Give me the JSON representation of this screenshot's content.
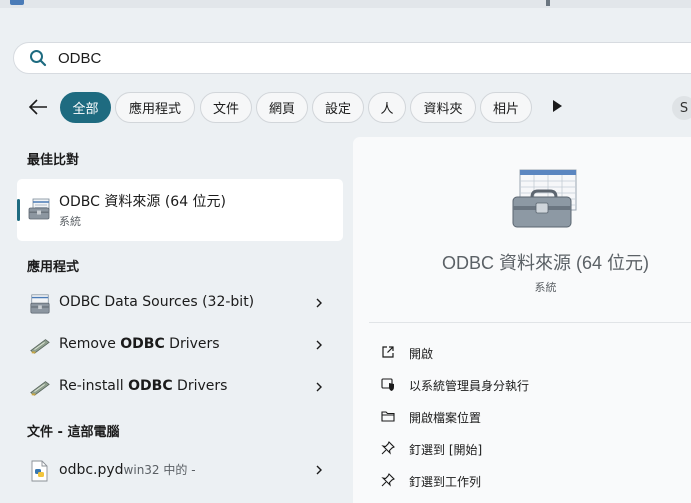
{
  "search": {
    "query": "ODBC"
  },
  "filters": {
    "chips": [
      {
        "label": "全部",
        "active": true
      },
      {
        "label": "應用程式"
      },
      {
        "label": "文件"
      },
      {
        "label": "網頁"
      },
      {
        "label": "設定"
      },
      {
        "label": "人"
      },
      {
        "label": "資料夾"
      },
      {
        "label": "相片"
      }
    ],
    "avatar_initial": "S"
  },
  "sections": {
    "best_match": "最佳比對",
    "apps": "應用程式",
    "documents": "文件 - 這部電腦"
  },
  "best_match": {
    "title": "ODBC 資料來源 (64 位元)",
    "subtitle": "系統"
  },
  "apps": [
    {
      "label": "ODBC Data Sources (32-bit)"
    },
    {
      "label_pre": "Remove ",
      "label_bold": "ODBC",
      "label_post": " Drivers"
    },
    {
      "label_pre": "Re-install ",
      "label_bold": "ODBC",
      "label_post": " Drivers"
    }
  ],
  "documents": [
    {
      "name": "odbc.pyd",
      "location": "win32 中的 -"
    }
  ],
  "detail": {
    "title": "ODBC 資料來源 (64 位元)",
    "subtitle": "系統",
    "actions": [
      {
        "label": "開啟",
        "icon": "open-external-icon"
      },
      {
        "label": "以系統管理員身分執行",
        "icon": "shield-icon"
      },
      {
        "label": "開啟檔案位置",
        "icon": "folder-icon"
      },
      {
        "label": "釘選到 [開始]",
        "icon": "pin-icon"
      },
      {
        "label": "釘選到工作列",
        "icon": "pin-icon"
      }
    ]
  },
  "colors": {
    "accent": "#1e6b80",
    "background": "#ecf0f3"
  }
}
